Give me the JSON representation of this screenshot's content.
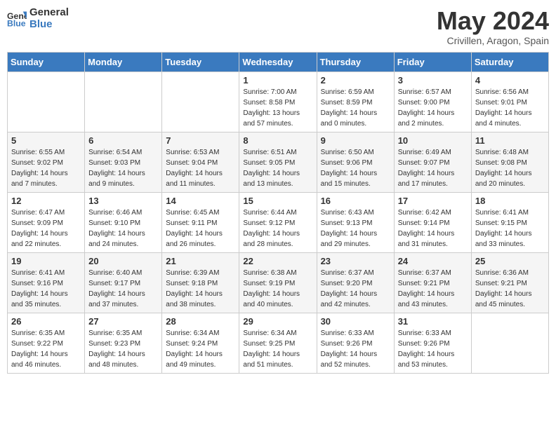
{
  "header": {
    "logo_general": "General",
    "logo_blue": "Blue",
    "month_title": "May 2024",
    "location": "Crivillen, Aragon, Spain"
  },
  "days_of_week": [
    "Sunday",
    "Monday",
    "Tuesday",
    "Wednesday",
    "Thursday",
    "Friday",
    "Saturday"
  ],
  "weeks": [
    [
      {
        "num": "",
        "info": ""
      },
      {
        "num": "",
        "info": ""
      },
      {
        "num": "",
        "info": ""
      },
      {
        "num": "1",
        "info": "Sunrise: 7:00 AM\nSunset: 8:58 PM\nDaylight: 13 hours\nand 57 minutes."
      },
      {
        "num": "2",
        "info": "Sunrise: 6:59 AM\nSunset: 8:59 PM\nDaylight: 14 hours\nand 0 minutes."
      },
      {
        "num": "3",
        "info": "Sunrise: 6:57 AM\nSunset: 9:00 PM\nDaylight: 14 hours\nand 2 minutes."
      },
      {
        "num": "4",
        "info": "Sunrise: 6:56 AM\nSunset: 9:01 PM\nDaylight: 14 hours\nand 4 minutes."
      }
    ],
    [
      {
        "num": "5",
        "info": "Sunrise: 6:55 AM\nSunset: 9:02 PM\nDaylight: 14 hours\nand 7 minutes."
      },
      {
        "num": "6",
        "info": "Sunrise: 6:54 AM\nSunset: 9:03 PM\nDaylight: 14 hours\nand 9 minutes."
      },
      {
        "num": "7",
        "info": "Sunrise: 6:53 AM\nSunset: 9:04 PM\nDaylight: 14 hours\nand 11 minutes."
      },
      {
        "num": "8",
        "info": "Sunrise: 6:51 AM\nSunset: 9:05 PM\nDaylight: 14 hours\nand 13 minutes."
      },
      {
        "num": "9",
        "info": "Sunrise: 6:50 AM\nSunset: 9:06 PM\nDaylight: 14 hours\nand 15 minutes."
      },
      {
        "num": "10",
        "info": "Sunrise: 6:49 AM\nSunset: 9:07 PM\nDaylight: 14 hours\nand 17 minutes."
      },
      {
        "num": "11",
        "info": "Sunrise: 6:48 AM\nSunset: 9:08 PM\nDaylight: 14 hours\nand 20 minutes."
      }
    ],
    [
      {
        "num": "12",
        "info": "Sunrise: 6:47 AM\nSunset: 9:09 PM\nDaylight: 14 hours\nand 22 minutes."
      },
      {
        "num": "13",
        "info": "Sunrise: 6:46 AM\nSunset: 9:10 PM\nDaylight: 14 hours\nand 24 minutes."
      },
      {
        "num": "14",
        "info": "Sunrise: 6:45 AM\nSunset: 9:11 PM\nDaylight: 14 hours\nand 26 minutes."
      },
      {
        "num": "15",
        "info": "Sunrise: 6:44 AM\nSunset: 9:12 PM\nDaylight: 14 hours\nand 28 minutes."
      },
      {
        "num": "16",
        "info": "Sunrise: 6:43 AM\nSunset: 9:13 PM\nDaylight: 14 hours\nand 29 minutes."
      },
      {
        "num": "17",
        "info": "Sunrise: 6:42 AM\nSunset: 9:14 PM\nDaylight: 14 hours\nand 31 minutes."
      },
      {
        "num": "18",
        "info": "Sunrise: 6:41 AM\nSunset: 9:15 PM\nDaylight: 14 hours\nand 33 minutes."
      }
    ],
    [
      {
        "num": "19",
        "info": "Sunrise: 6:41 AM\nSunset: 9:16 PM\nDaylight: 14 hours\nand 35 minutes."
      },
      {
        "num": "20",
        "info": "Sunrise: 6:40 AM\nSunset: 9:17 PM\nDaylight: 14 hours\nand 37 minutes."
      },
      {
        "num": "21",
        "info": "Sunrise: 6:39 AM\nSunset: 9:18 PM\nDaylight: 14 hours\nand 38 minutes."
      },
      {
        "num": "22",
        "info": "Sunrise: 6:38 AM\nSunset: 9:19 PM\nDaylight: 14 hours\nand 40 minutes."
      },
      {
        "num": "23",
        "info": "Sunrise: 6:37 AM\nSunset: 9:20 PM\nDaylight: 14 hours\nand 42 minutes."
      },
      {
        "num": "24",
        "info": "Sunrise: 6:37 AM\nSunset: 9:21 PM\nDaylight: 14 hours\nand 43 minutes."
      },
      {
        "num": "25",
        "info": "Sunrise: 6:36 AM\nSunset: 9:21 PM\nDaylight: 14 hours\nand 45 minutes."
      }
    ],
    [
      {
        "num": "26",
        "info": "Sunrise: 6:35 AM\nSunset: 9:22 PM\nDaylight: 14 hours\nand 46 minutes."
      },
      {
        "num": "27",
        "info": "Sunrise: 6:35 AM\nSunset: 9:23 PM\nDaylight: 14 hours\nand 48 minutes."
      },
      {
        "num": "28",
        "info": "Sunrise: 6:34 AM\nSunset: 9:24 PM\nDaylight: 14 hours\nand 49 minutes."
      },
      {
        "num": "29",
        "info": "Sunrise: 6:34 AM\nSunset: 9:25 PM\nDaylight: 14 hours\nand 51 minutes."
      },
      {
        "num": "30",
        "info": "Sunrise: 6:33 AM\nSunset: 9:26 PM\nDaylight: 14 hours\nand 52 minutes."
      },
      {
        "num": "31",
        "info": "Sunrise: 6:33 AM\nSunset: 9:26 PM\nDaylight: 14 hours\nand 53 minutes."
      },
      {
        "num": "",
        "info": ""
      }
    ]
  ]
}
